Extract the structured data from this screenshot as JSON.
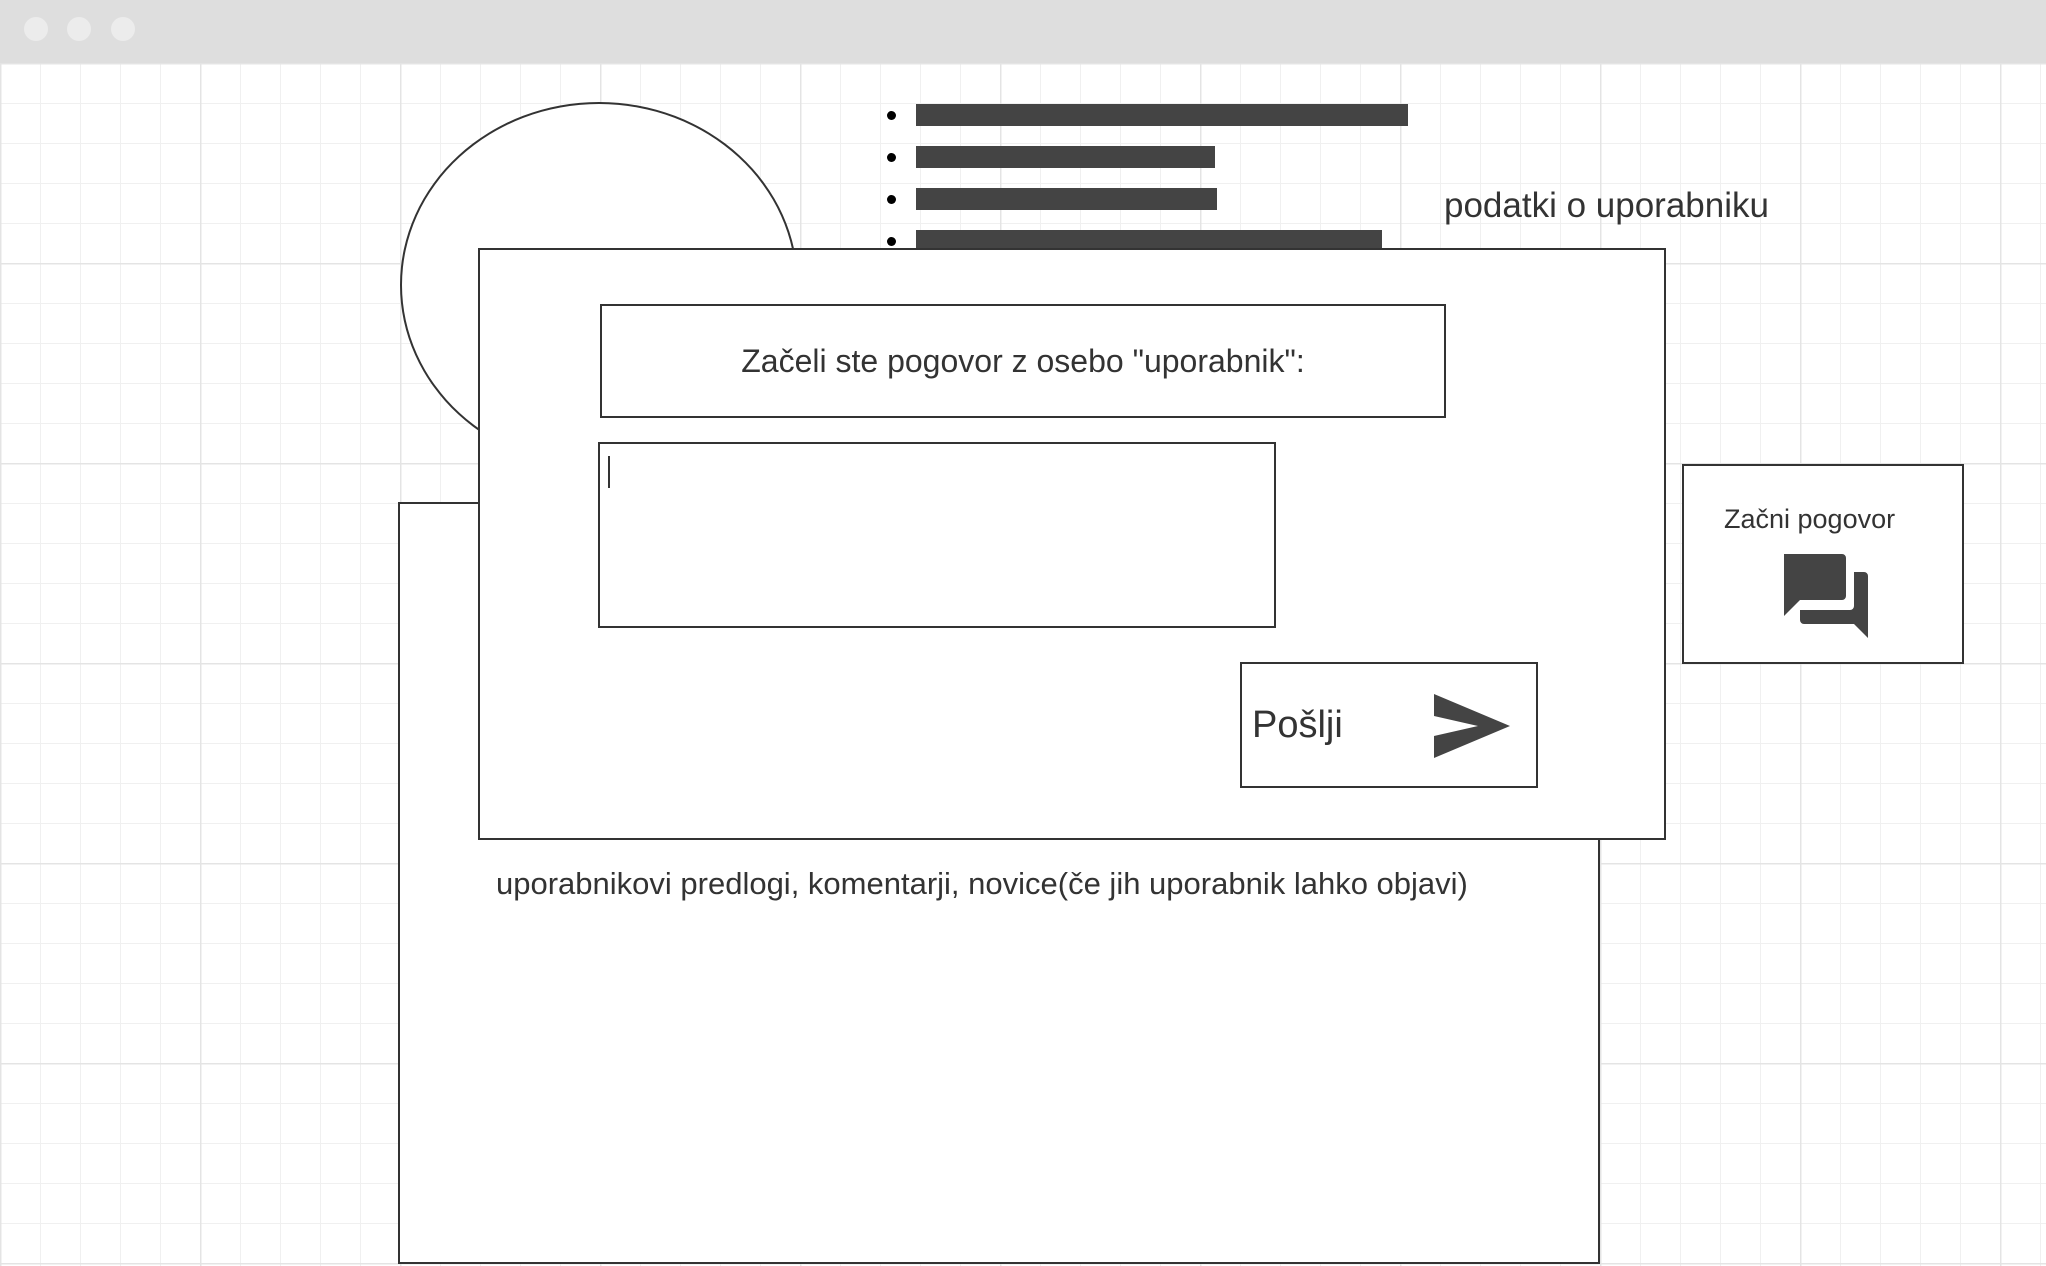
{
  "window": {
    "controls": [
      "close-dot",
      "minimize-dot",
      "maximize-dot"
    ]
  },
  "profile": {
    "info_label": "podatki o uporabniku",
    "info_lines_count": 4
  },
  "posts": {
    "text": "uporabnikovi predlogi, komentarji, novice(če jih uporabnik lahko objavi)"
  },
  "start_chat": {
    "label": "Začni pogovor",
    "icon": "chat-bubbles-icon"
  },
  "dialog": {
    "header": "Začeli ste pogovor z osebo \"uporabnik\":",
    "message_value": "",
    "send_label": "Pošlji",
    "send_icon": "send-arrow-icon"
  },
  "colors": {
    "stroke": "#333333",
    "bar": "#444444",
    "titlebar": "#dedede",
    "grid": "#e4e4e4"
  }
}
